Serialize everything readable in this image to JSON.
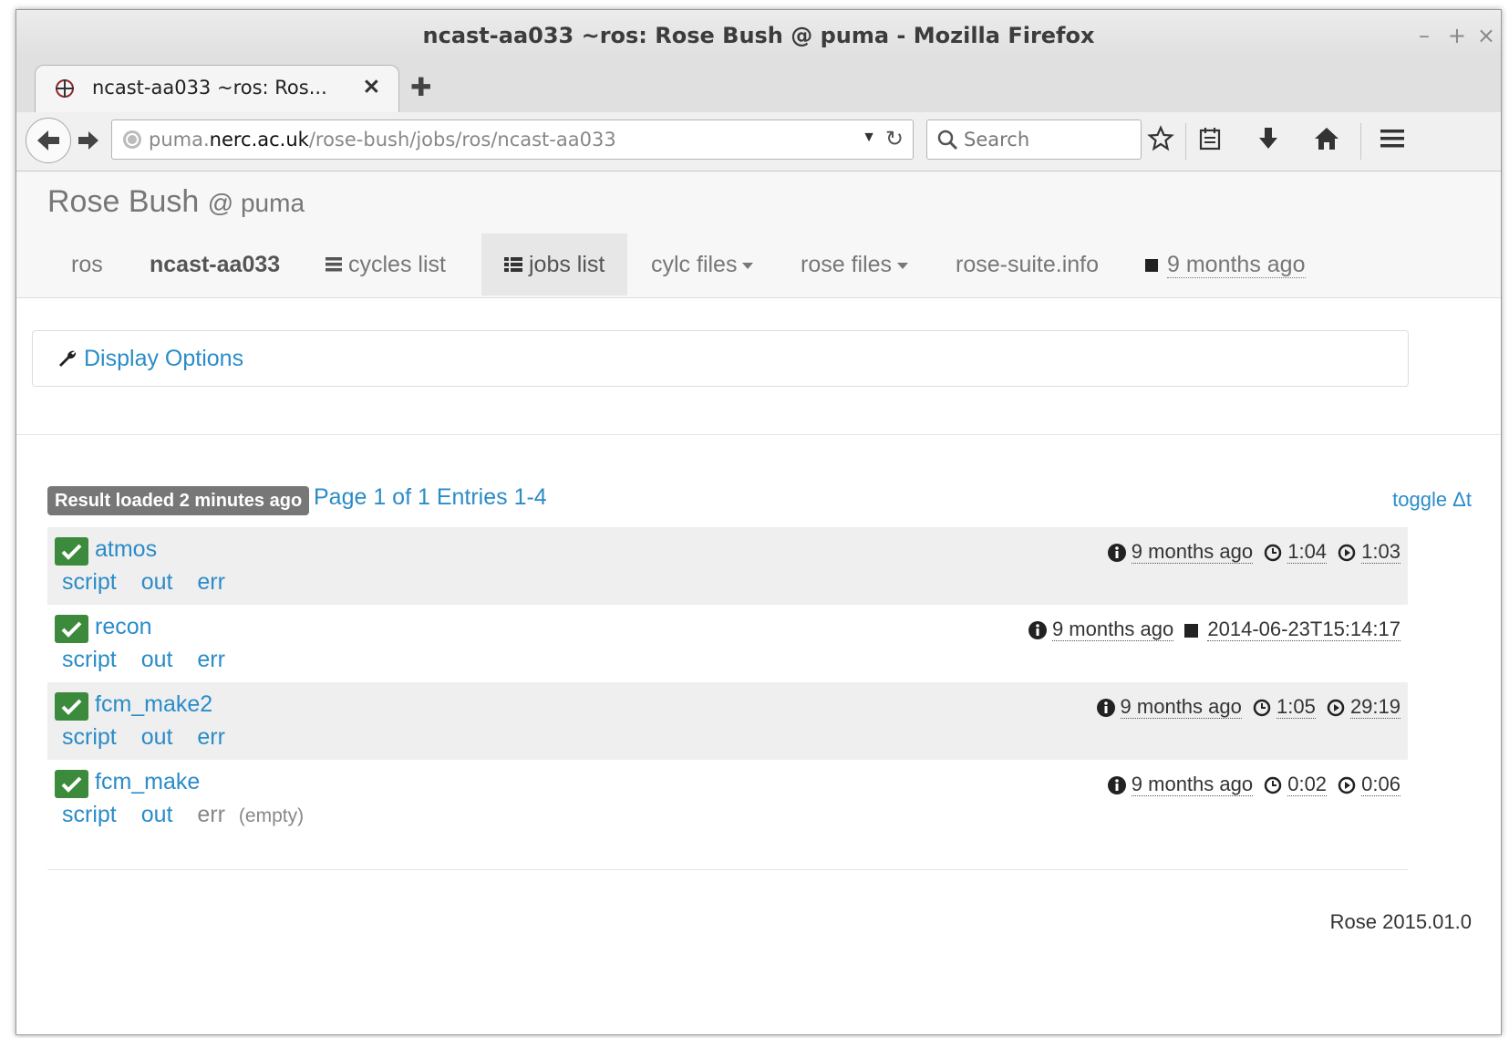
{
  "window": {
    "title": "ncast-aa033 ~ros: Rose Bush @ puma - Mozilla Firefox",
    "controls": {
      "minimize": "–",
      "maximize": "+",
      "close": "×"
    }
  },
  "tab": {
    "label": "ncast-aa033 ~ros: Ros...",
    "close": "✕",
    "new_tab": "✚"
  },
  "toolbar": {
    "url_host_prefix": "puma.",
    "url_host": "nerc.ac.uk",
    "url_path": "/rose-bush/jobs/ros/ncast-aa033",
    "search_placeholder": "Search"
  },
  "header": {
    "brand": "Rose Bush",
    "brand_at": "@ puma",
    "nav": {
      "user": "ros",
      "suite": "ncast-aa033",
      "cycles": "cycles list",
      "jobs": "jobs list",
      "cylc_files": "cylc files",
      "rose_files": "rose files",
      "suite_info": "rose-suite.info",
      "updated": "9 months ago"
    }
  },
  "display_options": "Display Options",
  "summary": {
    "badge": "Result loaded 2 minutes ago",
    "page_info": "Page 1 of 1 Entries 1-4",
    "toggle": "toggle Δt"
  },
  "jobs": [
    {
      "name": "atmos",
      "script": "script",
      "out": "out",
      "err": "err",
      "submitted": "9 months ago",
      "queue": "1:04",
      "run": "1:03"
    },
    {
      "name": "recon",
      "script": "script",
      "out": "out",
      "err": "err",
      "submitted": "9 months ago",
      "time": "2014-06-23T15:14:17"
    },
    {
      "name": "fcm_make2",
      "script": "script",
      "out": "out",
      "err": "err",
      "submitted": "9 months ago",
      "queue": "1:05",
      "run": "29:19"
    },
    {
      "name": "fcm_make",
      "script": "script",
      "out": "out",
      "err": "err",
      "err_note": "(empty)",
      "submitted": "9 months ago",
      "queue": "0:02",
      "run": "0:06"
    }
  ],
  "footer": "Rose 2015.01.0",
  "colors": {
    "link": "#2a8cc8",
    "success": "#3c8a3c",
    "badge": "#777777"
  }
}
